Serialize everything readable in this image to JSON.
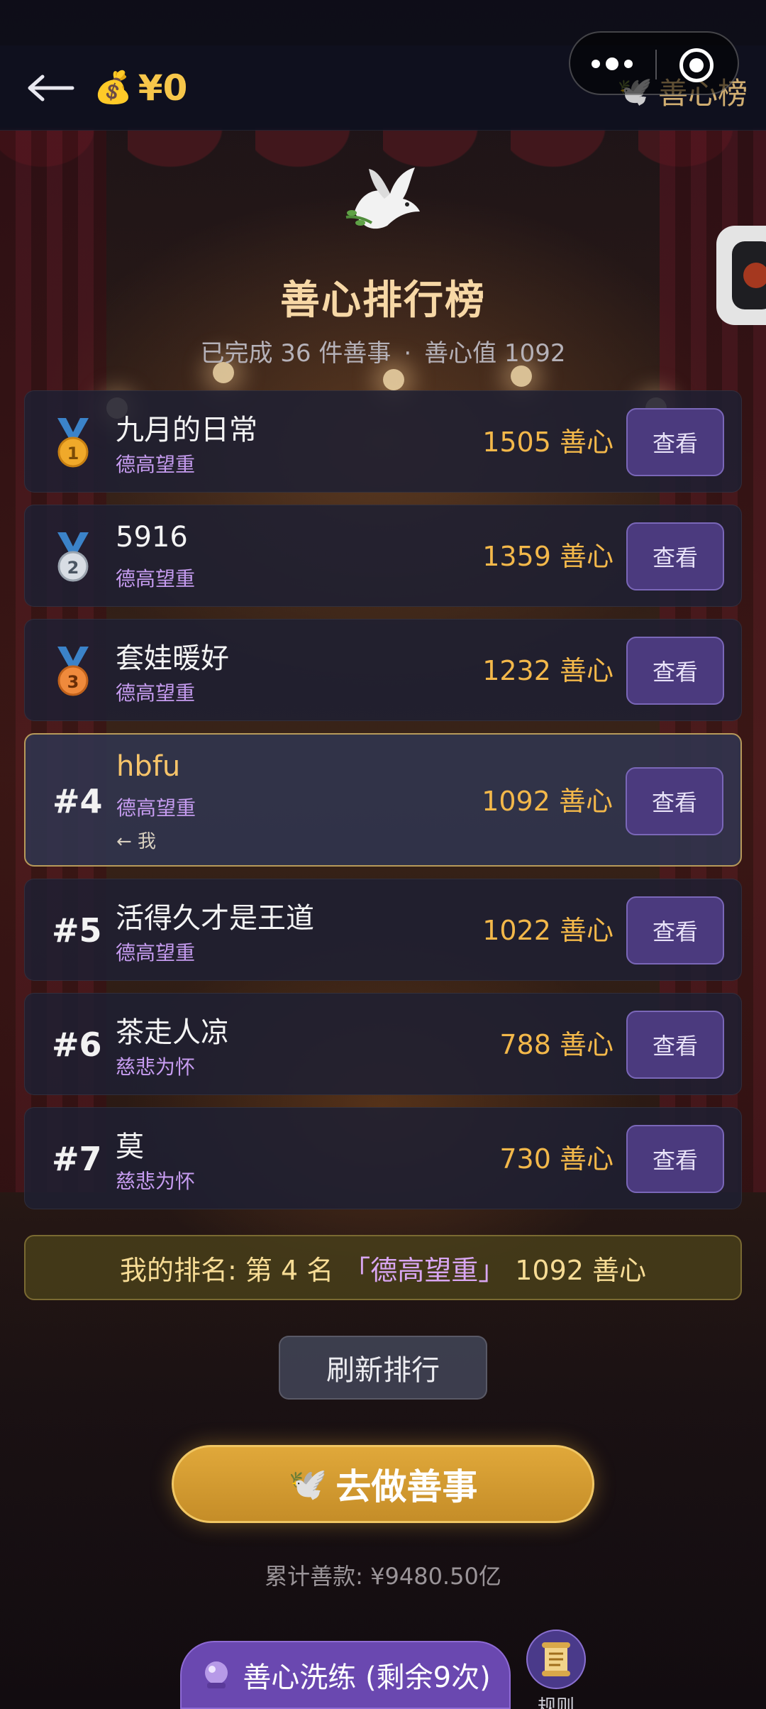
{
  "top_bar": {
    "coin_amount": "¥0",
    "page_name": "善心榜"
  },
  "header": {
    "title": "善心排行榜",
    "stats_completed": "已完成 36 件善事",
    "stats_separator": "·",
    "stats_value": "善心值 1092"
  },
  "ranking": [
    {
      "rank": "1",
      "name": "九月的日常",
      "title": "德高望重",
      "score": "1505 善心",
      "button": "查看",
      "medal": "gold"
    },
    {
      "rank": "2",
      "name": "5916",
      "title": "德高望重",
      "score": "1359 善心",
      "button": "查看",
      "medal": "silver"
    },
    {
      "rank": "3",
      "name": "套娃暖好",
      "title": "德高望重",
      "score": "1232 善心",
      "button": "查看",
      "medal": "bronze"
    },
    {
      "rank": "#4",
      "name": "hbfu",
      "title": "德高望重",
      "me_tag": "← 我",
      "score": "1092 善心",
      "button": "查看"
    },
    {
      "rank": "#5",
      "name": "活得久才是王道",
      "title": "德高望重",
      "score": "1022 善心",
      "button": "查看"
    },
    {
      "rank": "#6",
      "name": "茶走人凉",
      "title": "慈悲为怀",
      "score": "788 善心",
      "button": "查看"
    },
    {
      "rank": "#7",
      "name": "莫",
      "title": "慈悲为怀",
      "score": "730 善心",
      "button": "查看"
    }
  ],
  "my_rank": {
    "prefix": "我的排名: 第 4 名",
    "title": "「德高望重」",
    "score": "1092 善心"
  },
  "buttons": {
    "refresh": "刷新排行",
    "go_do_good": "去做善事",
    "train": "善心洗练 (剩余9次)",
    "rules": "规则"
  },
  "total_donation": "累计善款: ¥9480.50亿",
  "colors": {
    "gold": "#f3b84a",
    "purple": "#c69cf0",
    "button_purple": "#4b3a7e",
    "go_button": "#d89c30"
  }
}
